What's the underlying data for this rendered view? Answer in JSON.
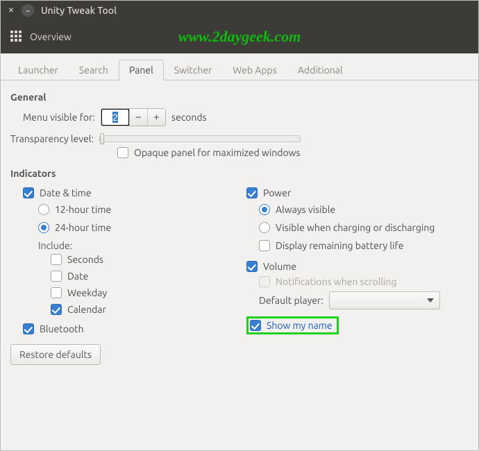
{
  "window": {
    "title": "Unity Tweak Tool"
  },
  "toolbar": {
    "overview": "Overview"
  },
  "watermark": "www.2daygeek.com",
  "tabs": {
    "launcher": "Launcher",
    "search": "Search",
    "panel": "Panel",
    "switcher": "Switcher",
    "webapps": "Web Apps",
    "additional": "Additional"
  },
  "sections": {
    "general": "General",
    "indicators": "Indicators"
  },
  "general": {
    "menu_visible_for": "Menu visible for:",
    "menu_seconds_value": "2",
    "seconds": "seconds",
    "transparency_level": "Transparency level:",
    "opaque_panel": "Opaque panel for maximized windows"
  },
  "indicators": {
    "date_time": "Date & time",
    "hour12": "12-hour time",
    "hour24": "24-hour time",
    "include": "Include:",
    "seconds": "Seconds",
    "date": "Date",
    "weekday": "Weekday",
    "calendar": "Calendar",
    "bluetooth": "Bluetooth",
    "power": "Power",
    "always_visible": "Always visible",
    "visible_charging": "Visible when charging or discharging",
    "remaining_battery": "Display remaining battery life",
    "volume": "Volume",
    "notifications_scrolling": "Notifications when scrolling",
    "default_player": "Default player:",
    "show_my_name": "Show my name"
  },
  "buttons": {
    "restore_defaults": "Restore defaults"
  }
}
